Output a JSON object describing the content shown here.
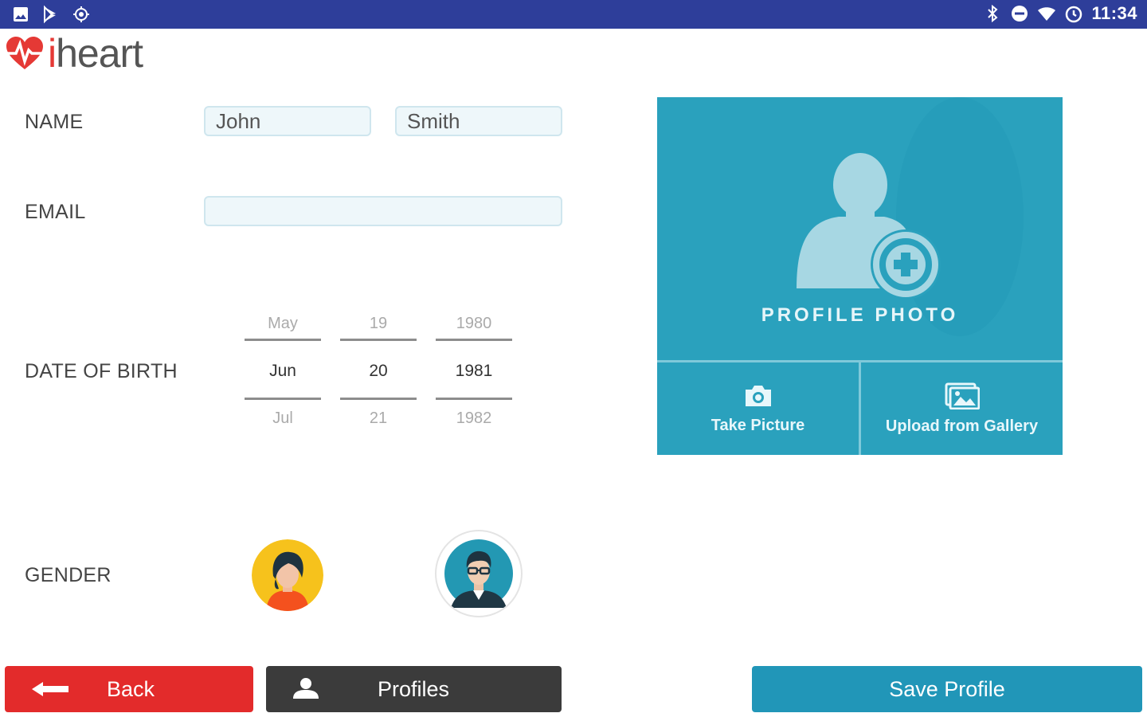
{
  "status_bar": {
    "time": "11:34",
    "left_icons": [
      "image-icon",
      "play-store-icon",
      "gps-icon"
    ],
    "right_icons": [
      "bluetooth-icon",
      "do-not-disturb-icon",
      "wifi-icon",
      "alarm-icon"
    ],
    "background": "#2e3e9a"
  },
  "app": {
    "logo_i": "i",
    "logo_rest": "heart",
    "brand_color": "#e53935"
  },
  "form": {
    "name_label": "NAME",
    "first_name": "John",
    "last_name": "Smith",
    "email_label": "EMAIL",
    "email_value": "",
    "dob_label": "DATE OF BIRTH",
    "dob": {
      "month": {
        "prev": "May",
        "current": "Jun",
        "next": "Jul"
      },
      "day": {
        "prev": "19",
        "current": "20",
        "next": "21"
      },
      "year": {
        "prev": "1980",
        "current": "1981",
        "next": "1982"
      }
    },
    "gender_label": "GENDER",
    "gender_options": [
      "female-avatar",
      "male-avatar"
    ]
  },
  "photo": {
    "caption": "PROFILE PHOTO",
    "take_picture": "Take Picture",
    "upload_gallery": "Upload from Gallery",
    "panel_color": "#2aa1bd"
  },
  "actions": {
    "back": "Back",
    "profiles": "Profiles",
    "save": "Save Profile",
    "back_color": "#e32b2b",
    "profiles_color": "#3b3b3b",
    "save_color": "#2196b8"
  }
}
